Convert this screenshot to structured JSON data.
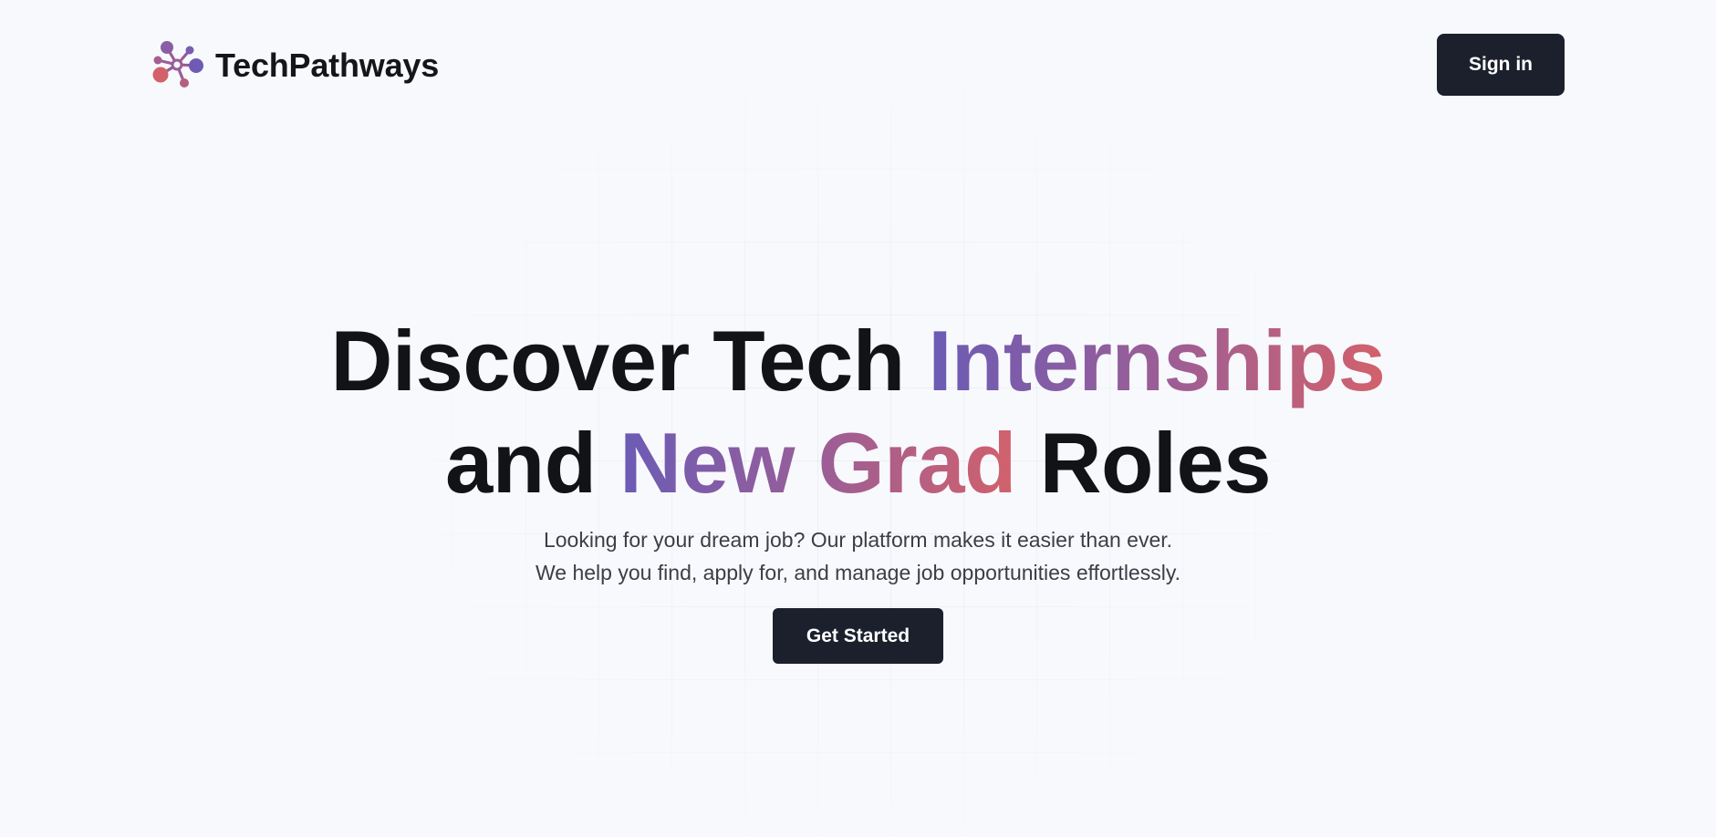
{
  "brand": {
    "name": "TechPathways",
    "logo_icon": "molecule-icon",
    "logo_colors": [
      "#6b5bb5",
      "#9a5e97",
      "#d2616b"
    ]
  },
  "header": {
    "signin_label": "Sign in"
  },
  "hero": {
    "line1_plain": "Discover Tech ",
    "line1_accent": "Internships",
    "line2_plain_start": "and ",
    "line2_accent": "New Grad",
    "line2_plain_end": " Roles",
    "subtitle_line1": "Looking for your dream job? Our platform makes it easier than ever.",
    "subtitle_line2": "We help you find, apply for, and manage job opportunities effortlessly.",
    "cta_label": "Get Started"
  },
  "colors": {
    "background": "#f8f9fc",
    "button": "#1b202c",
    "heading": "#121317",
    "gradient_start": "#6b5bb5",
    "gradient_end": "#d2616b"
  }
}
